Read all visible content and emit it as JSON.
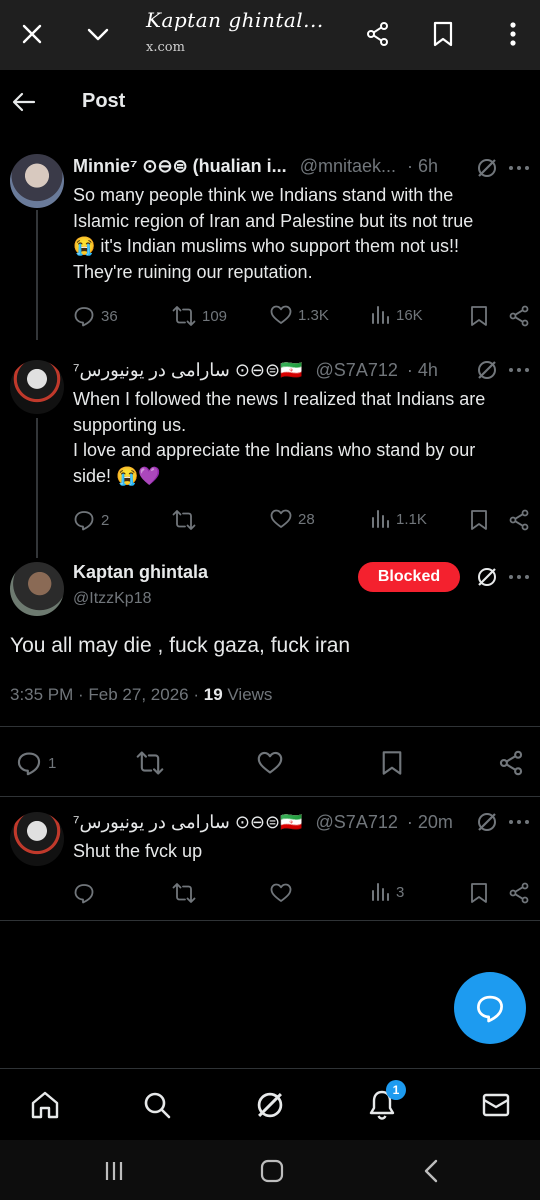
{
  "browser": {
    "title": "Kaptan ghintal...",
    "domain": "x.com"
  },
  "header": {
    "title": "Post"
  },
  "tweets": [
    {
      "name": "Minnie⁷ ⊙⊖⊜ (hualian i...",
      "handle": "@mnitaek...",
      "time": "· 6h",
      "lines": [
        "So many people think we Indians stand with the",
        "Islamic region of Iran and Palestine but its not true",
        "😭 it's Indian muslims who support them not us!!",
        "They're ruining our reputation."
      ],
      "replies": "36",
      "reposts": "109",
      "likes": "1.3K",
      "views": "16K"
    },
    {
      "name": "سارامی در یونیورس⁷ ⊙⊖⊜🇮🇷",
      "handle": "@S7A712",
      "time": "· 4h",
      "lines": [
        "When I followed the news I realized that Indians are",
        "supporting us.",
        "I love and appreciate the Indians who stand by our",
        "side! 😭💜"
      ],
      "replies": "2",
      "reposts": "",
      "likes": "28",
      "views": "1.1K"
    }
  ],
  "main": {
    "name": "Kaptan ghintala",
    "handle": "@ItzzKp18",
    "blocked_label": "Blocked",
    "text": "You all may die , fuck gaza, fuck iran",
    "timestamp": "3:35 PM · Feb 27, 2026 ·",
    "views_count": "19",
    "views_label": "Views",
    "replies": "1"
  },
  "reply": {
    "name": "سارامی در یونیورس⁷ ⊙⊖⊜🇮🇷",
    "handle": "@S7A712",
    "time": "· 20m",
    "text": "Shut the fvck up",
    "views": "3"
  },
  "nav": {
    "notification_count": "1"
  },
  "colors": {
    "accent": "#1d9bf0",
    "blocked": "#f4212e",
    "muted": "#71767b"
  }
}
